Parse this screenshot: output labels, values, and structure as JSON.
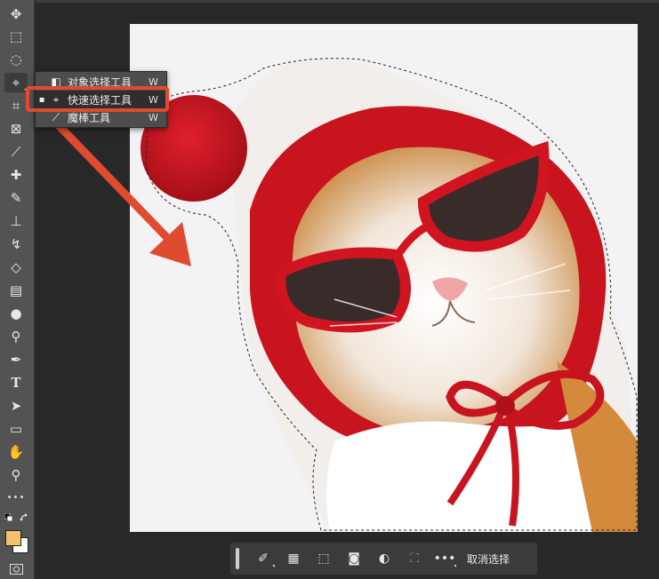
{
  "toolbar": {
    "tools": [
      {
        "name": "move-tool",
        "icon": "✥"
      },
      {
        "name": "marquee-tool",
        "icon": "⬚"
      },
      {
        "name": "lasso-tool",
        "icon": "◌"
      },
      {
        "name": "quick-selection-tool",
        "icon": "⌖"
      },
      {
        "name": "crop-tool",
        "icon": "⌗"
      },
      {
        "name": "frame-tool",
        "icon": "⊠"
      },
      {
        "name": "eyedropper-tool",
        "icon": "⟋"
      },
      {
        "name": "healing-brush-tool",
        "icon": "✚"
      },
      {
        "name": "brush-tool",
        "icon": "✎"
      },
      {
        "name": "stamp-tool",
        "icon": "⊥"
      },
      {
        "name": "history-brush-tool",
        "icon": "↯"
      },
      {
        "name": "eraser-tool",
        "icon": "◇"
      },
      {
        "name": "gradient-tool",
        "icon": "▤"
      },
      {
        "name": "blur-tool",
        "icon": "●"
      },
      {
        "name": "dodge-tool",
        "icon": "⚲"
      },
      {
        "name": "pen-tool",
        "icon": "✒"
      },
      {
        "name": "type-tool",
        "icon": "T"
      },
      {
        "name": "path-selection-tool",
        "icon": "➤"
      },
      {
        "name": "rectangle-tool",
        "icon": "▭"
      },
      {
        "name": "hand-tool",
        "icon": "✋"
      },
      {
        "name": "zoom-tool",
        "icon": "⚲"
      },
      {
        "name": "more-tools",
        "icon": "•••"
      }
    ],
    "foreground_color": "#f4c26b",
    "background_color": "#ffffff"
  },
  "flyout": {
    "items": [
      {
        "label": "对象选择工具",
        "key": "W"
      },
      {
        "label": "快速选择工具",
        "key": "W"
      },
      {
        "label": "魔棒工具",
        "key": "W"
      }
    ]
  },
  "bottom_bar": {
    "deselect_label": "取消选择",
    "more_icon": "•••"
  },
  "colors": {
    "accent_highlight": "#e04a2e"
  }
}
